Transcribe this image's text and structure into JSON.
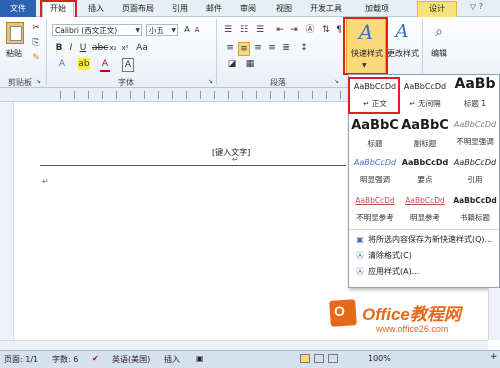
{
  "tabs": {
    "file": "文件",
    "home": "开始",
    "insert": "插入",
    "page_layout": "页面布局",
    "references": "引用",
    "mailings": "邮件",
    "review": "审阅",
    "view": "视图",
    "developer": "开发工具",
    "addins": "加载项",
    "design": "设计"
  },
  "ribbon": {
    "paste": "粘贴",
    "font_name": "Calibri (西文正文)",
    "font_size": "小五",
    "quick_styles": "快速样式",
    "change_styles": "更改样式",
    "editing": "编辑",
    "groups": {
      "clipboard": "剪贴板",
      "font": "字体",
      "paragraph": "段落"
    }
  },
  "document": {
    "header_text": "[键入文字]",
    "para_mark": "↵"
  },
  "gallery": {
    "styles": [
      {
        "preview": "AaBbCcDd",
        "name": "↵ 正文"
      },
      {
        "preview": "AaBbCcDd",
        "name": "↵ 无间隔"
      },
      {
        "preview": "AaBb",
        "name": "标题 1"
      },
      {
        "preview": "AaBbC",
        "name": "标题"
      },
      {
        "preview": "AaBbC",
        "name": "副标题"
      },
      {
        "preview": "AaBbCcDd",
        "name": "不明显强调"
      },
      {
        "preview": "AaBbCcDd",
        "name": "明显强调"
      },
      {
        "preview": "AaBbCcDd",
        "name": "要点"
      },
      {
        "preview": "AaBbCcDd",
        "name": "引用"
      },
      {
        "preview": "AaBbCcDd",
        "name": "不明显参考"
      },
      {
        "preview": "AaBbCcDd",
        "name": "明显参考"
      },
      {
        "preview": "AaBbCcDd",
        "name": "书籍标题"
      }
    ],
    "menu": {
      "save_as_new": "将所选内容保存为新快速样式(Q)...",
      "clear": "清除格式(C)",
      "apply": "应用样式(A)..."
    }
  },
  "status": {
    "page": "页面: 1/1",
    "words": "字数: 6",
    "language": "英语(美国)",
    "mode": "插入",
    "zoom": "100%"
  },
  "watermark": {
    "brand": "Office教程网",
    "url": "www.office26.com"
  }
}
